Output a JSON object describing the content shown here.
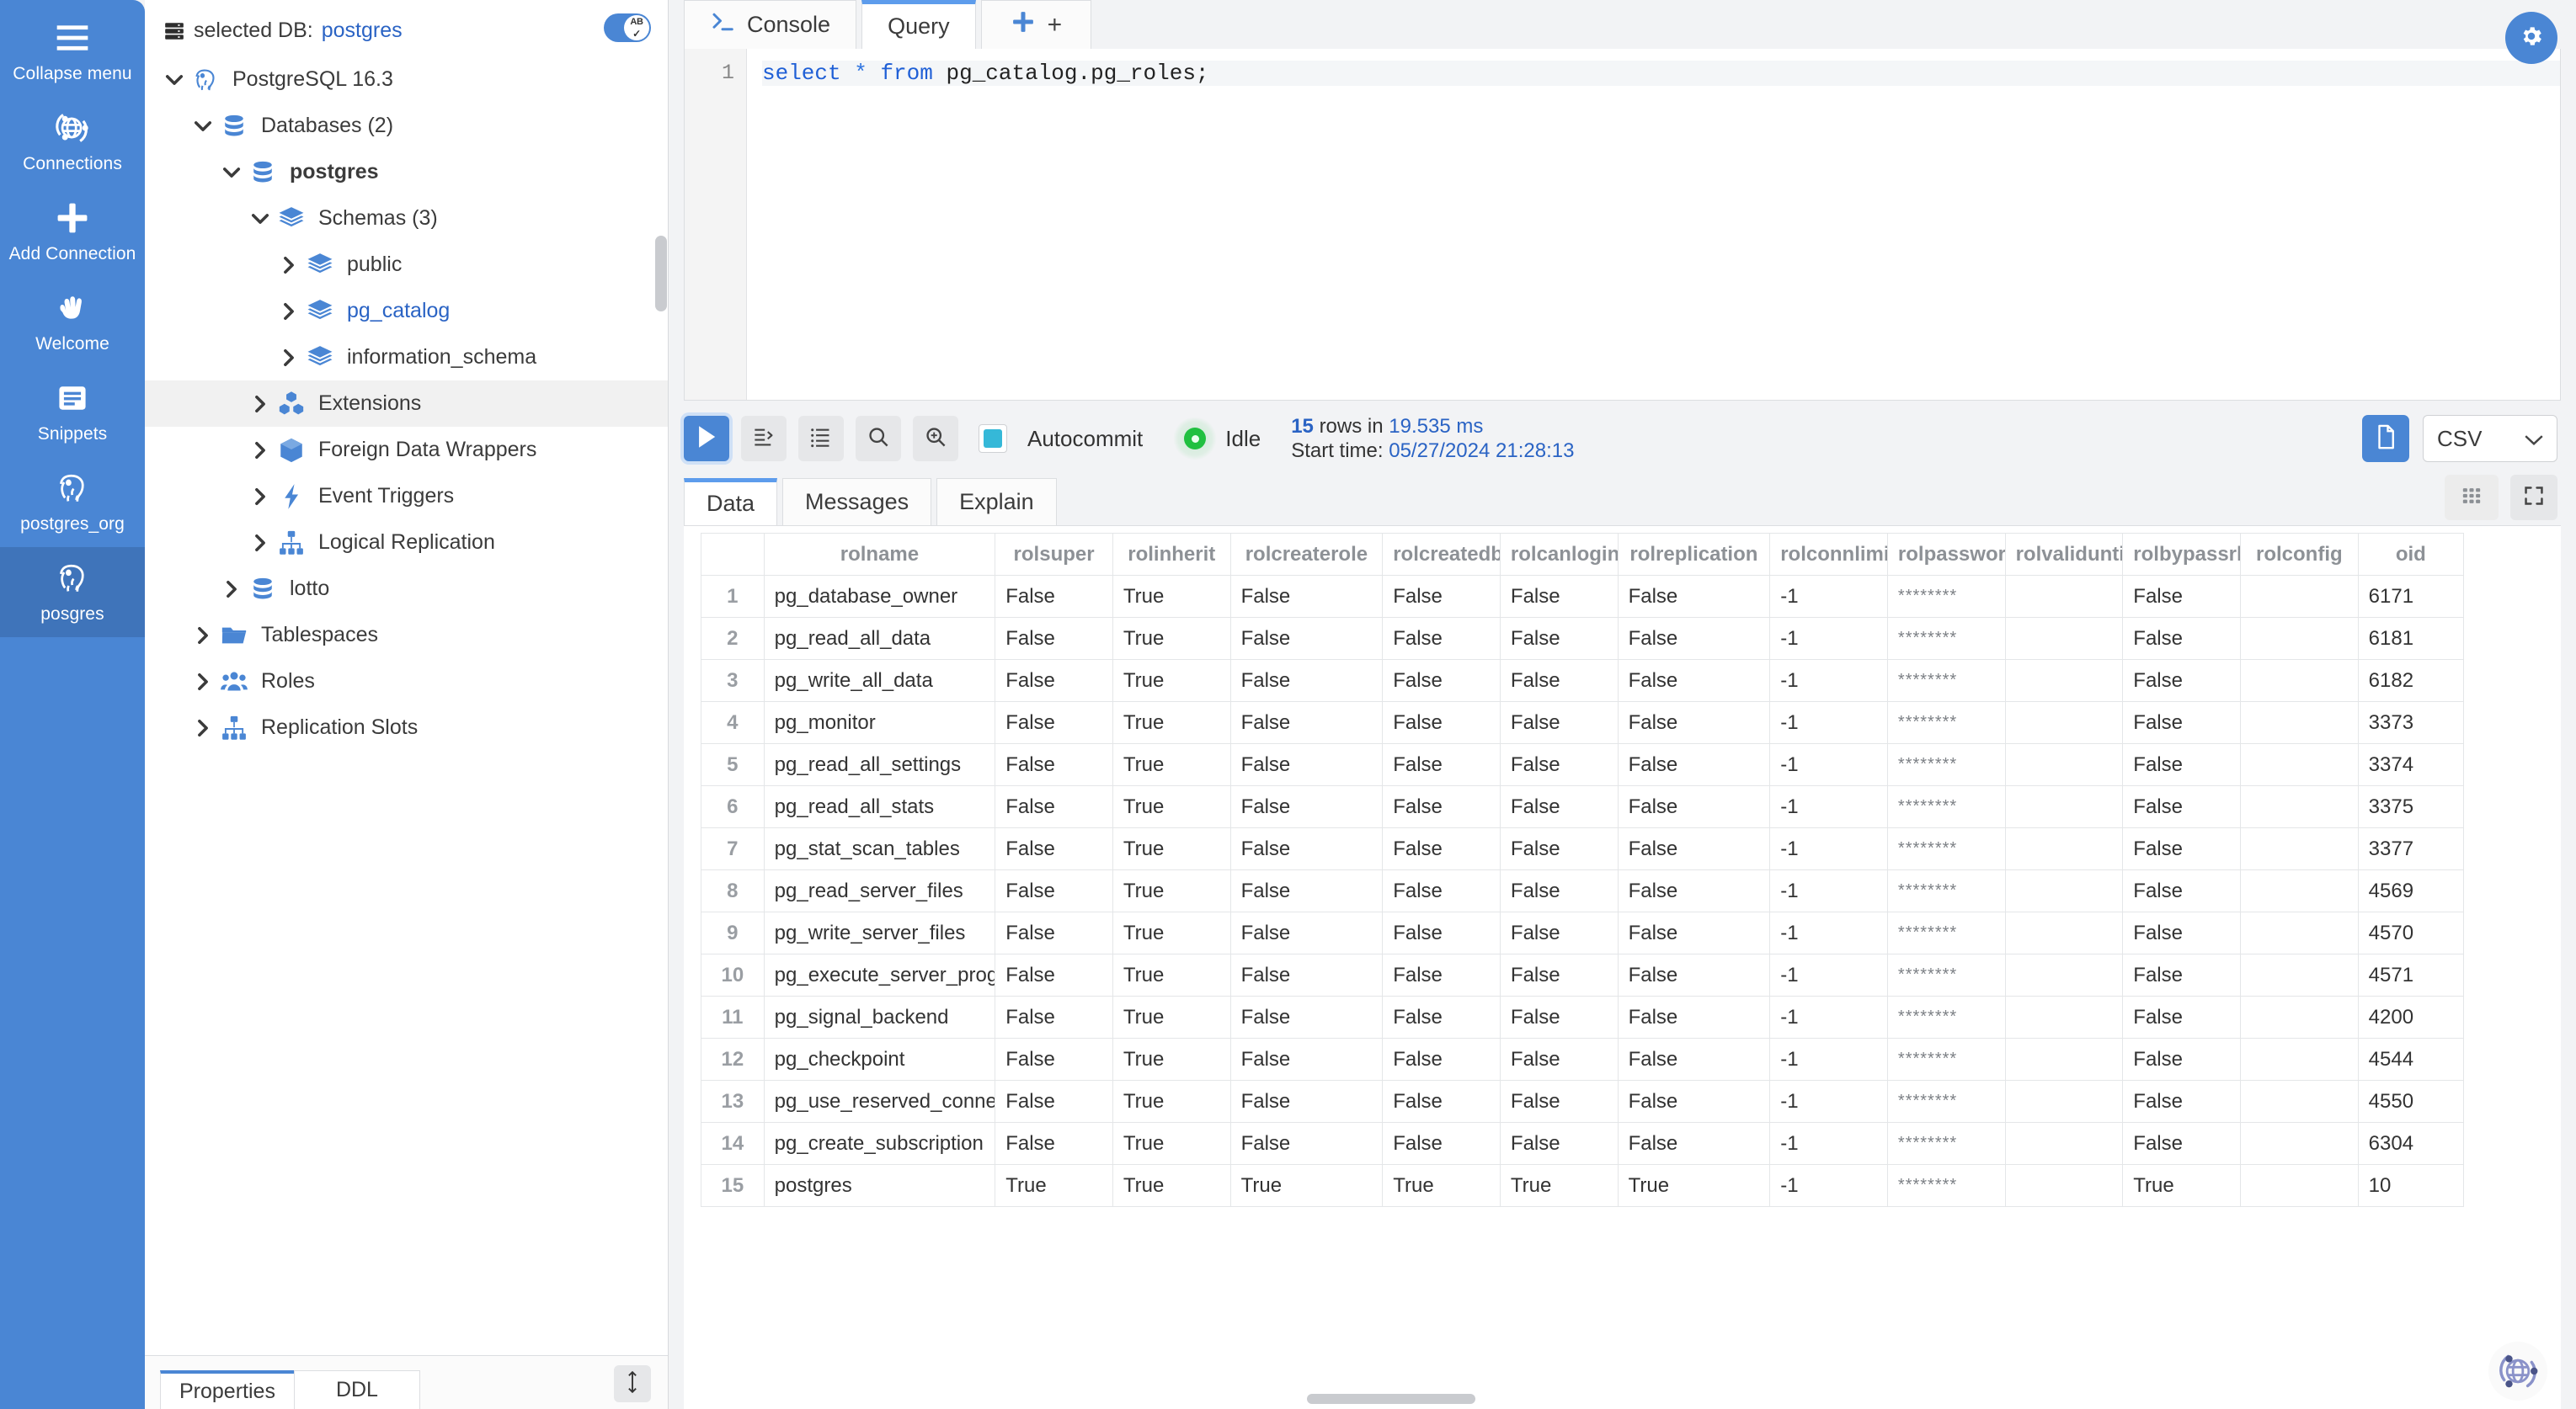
{
  "rail": {
    "items": [
      {
        "label": "Collapse menu",
        "icon": "hamburger-menu-icon",
        "active": false
      },
      {
        "label": "Connections",
        "icon": "connections-globe-icon",
        "active": false
      },
      {
        "label": "Add Connection",
        "icon": "plus-icon",
        "active": false
      },
      {
        "label": "Welcome",
        "icon": "hand-wave-icon",
        "active": false
      },
      {
        "label": "Snippets",
        "icon": "snippets-book-icon",
        "active": false
      },
      {
        "label": "postgres_org",
        "icon": "postgres-elephant-icon",
        "active": false
      },
      {
        "label": "posgres",
        "icon": "postgres-elephant-icon",
        "active": true
      }
    ]
  },
  "tree": {
    "header": {
      "prefix": "selected DB:",
      "db": "postgres",
      "icon": "server-icon"
    },
    "autocomplete_toggle": {
      "label": "AB",
      "state": "on",
      "icon": "ab-check-icon"
    },
    "nodes": [
      {
        "label": "PostgreSQL 16.3",
        "indent": 0,
        "state": "expanded",
        "icon": "postgres-elephant-icon",
        "style": "normal"
      },
      {
        "label": "Databases (2)",
        "indent": 1,
        "state": "expanded",
        "icon": "database-icon",
        "style": "normal"
      },
      {
        "label": "postgres",
        "indent": 2,
        "state": "expanded",
        "icon": "database-icon",
        "style": "bold"
      },
      {
        "label": "Schemas (3)",
        "indent": 3,
        "state": "expanded",
        "icon": "schema-layers-icon",
        "style": "normal"
      },
      {
        "label": "public",
        "indent": 4,
        "state": "collapsed",
        "icon": "schema-layers-icon",
        "style": "normal"
      },
      {
        "label": "pg_catalog",
        "indent": 4,
        "state": "collapsed",
        "icon": "schema-layers-icon",
        "style": "link"
      },
      {
        "label": "information_schema",
        "indent": 4,
        "state": "collapsed",
        "icon": "schema-layers-icon",
        "style": "normal"
      },
      {
        "label": "Extensions",
        "indent": 3,
        "state": "collapsed",
        "icon": "extensions-cubes-icon",
        "style": "normal",
        "highlighted": true
      },
      {
        "label": "Foreign Data Wrappers",
        "indent": 3,
        "state": "collapsed",
        "icon": "cube-icon",
        "style": "normal"
      },
      {
        "label": "Event Triggers",
        "indent": 3,
        "state": "collapsed",
        "icon": "lightning-bolt-icon",
        "style": "normal"
      },
      {
        "label": "Logical Replication",
        "indent": 3,
        "state": "collapsed",
        "icon": "hierarchy-icon",
        "style": "normal"
      },
      {
        "label": "lotto",
        "indent": 2,
        "state": "collapsed",
        "icon": "database-icon",
        "style": "normal"
      },
      {
        "label": "Tablespaces",
        "indent": 1,
        "state": "collapsed",
        "icon": "folder-icon",
        "style": "normal"
      },
      {
        "label": "Roles",
        "indent": 1,
        "state": "collapsed",
        "icon": "roles-users-icon",
        "style": "normal"
      },
      {
        "label": "Replication Slots",
        "indent": 1,
        "state": "collapsed",
        "icon": "hierarchy-icon",
        "style": "normal"
      }
    ],
    "footer_tabs": [
      {
        "label": "Properties",
        "active": true
      },
      {
        "label": "DDL",
        "active": false
      }
    ],
    "resize_button_icon": "up-down-arrow-icon"
  },
  "editor": {
    "tabs": [
      {
        "label": "Console",
        "icon": "terminal-prompt-icon",
        "active": false
      },
      {
        "label": "Query",
        "icon": "",
        "active": true
      },
      {
        "label": "+",
        "icon": "plus-icon",
        "active": false
      }
    ],
    "line_number": "1",
    "sql": {
      "kw_select": "select",
      "star": "*",
      "kw_from": "from",
      "target": "pg_catalog.pg_roles;"
    }
  },
  "results_toolbar": {
    "buttons": [
      {
        "name": "run-query-button",
        "icon": "play-icon"
      },
      {
        "name": "run-script-button",
        "icon": "run-script-icon"
      },
      {
        "name": "list-view-button",
        "icon": "list-icon"
      },
      {
        "name": "search-button",
        "icon": "search-icon"
      },
      {
        "name": "zoom-search-button",
        "icon": "search-plus-icon"
      }
    ],
    "autocommit_label": "Autocommit",
    "autocommit_checked": true,
    "status_label": "Idle",
    "status_color": "#20c040",
    "rows_count": "15",
    "rows_mid": "rows in",
    "duration": "19.535 ms",
    "start_time_label": "Start time:",
    "start_time_value": "05/27/2024 21:28:13",
    "export_button_icon": "document-icon",
    "format_select_value": "CSV",
    "format_chevron_icon": "chevron-down-icon"
  },
  "result_tabs": [
    {
      "label": "Data",
      "active": true
    },
    {
      "label": "Messages",
      "active": false
    },
    {
      "label": "Explain",
      "active": false
    }
  ],
  "result_tab_actions": [
    {
      "name": "grid-layout-button",
      "icon": "grid-icon"
    },
    {
      "name": "fullscreen-button",
      "icon": "expand-icon"
    }
  ],
  "gear_button": {
    "icon": "gear-icon"
  },
  "corner_logo": {
    "icon": "globe-network-icon"
  },
  "grid": {
    "columns": [
      {
        "key": "rowno",
        "label": "",
        "cls": "c-rowno"
      },
      {
        "key": "rolname",
        "label": "rolname",
        "cls": "c-rolname"
      },
      {
        "key": "rolsuper",
        "label": "rolsuper",
        "cls": "c-b"
      },
      {
        "key": "rolinherit",
        "label": "rolinherit",
        "cls": "c-b"
      },
      {
        "key": "rolcreaterole",
        "label": "rolcreaterole",
        "cls": "c-w"
      },
      {
        "key": "rolcreatedb",
        "label": "rolcreatedb",
        "cls": "c-b"
      },
      {
        "key": "rolcanlogin",
        "label": "rolcanlogin",
        "cls": "c-b"
      },
      {
        "key": "rolreplication",
        "label": "rolreplication",
        "cls": "c-w"
      },
      {
        "key": "rolconnlimit",
        "label": "rolconnlimit",
        "cls": "c-b"
      },
      {
        "key": "rolpassword",
        "label": "rolpassword",
        "cls": "c-b"
      },
      {
        "key": "rolvaliduntil",
        "label": "rolvaliduntil",
        "cls": "c-b"
      },
      {
        "key": "rolbypassrls",
        "label": "rolbypassrls",
        "cls": "c-b"
      },
      {
        "key": "rolconfig",
        "label": "rolconfig",
        "cls": "c-b"
      },
      {
        "key": "oid",
        "label": "oid",
        "cls": "c-oid"
      }
    ],
    "rows": [
      {
        "rowno": "1",
        "rolname": "pg_database_owner",
        "rolsuper": "False",
        "rolinherit": "True",
        "rolcreaterole": "False",
        "rolcreatedb": "False",
        "rolcanlogin": "False",
        "rolreplication": "False",
        "rolconnlimit": "-1",
        "rolpassword": "********",
        "rolvaliduntil": "",
        "rolbypassrls": "False",
        "rolconfig": "",
        "oid": "6171"
      },
      {
        "rowno": "2",
        "rolname": "pg_read_all_data",
        "rolsuper": "False",
        "rolinherit": "True",
        "rolcreaterole": "False",
        "rolcreatedb": "False",
        "rolcanlogin": "False",
        "rolreplication": "False",
        "rolconnlimit": "-1",
        "rolpassword": "********",
        "rolvaliduntil": "",
        "rolbypassrls": "False",
        "rolconfig": "",
        "oid": "6181"
      },
      {
        "rowno": "3",
        "rolname": "pg_write_all_data",
        "rolsuper": "False",
        "rolinherit": "True",
        "rolcreaterole": "False",
        "rolcreatedb": "False",
        "rolcanlogin": "False",
        "rolreplication": "False",
        "rolconnlimit": "-1",
        "rolpassword": "********",
        "rolvaliduntil": "",
        "rolbypassrls": "False",
        "rolconfig": "",
        "oid": "6182"
      },
      {
        "rowno": "4",
        "rolname": "pg_monitor",
        "rolsuper": "False",
        "rolinherit": "True",
        "rolcreaterole": "False",
        "rolcreatedb": "False",
        "rolcanlogin": "False",
        "rolreplication": "False",
        "rolconnlimit": "-1",
        "rolpassword": "********",
        "rolvaliduntil": "",
        "rolbypassrls": "False",
        "rolconfig": "",
        "oid": "3373"
      },
      {
        "rowno": "5",
        "rolname": "pg_read_all_settings",
        "rolsuper": "False",
        "rolinherit": "True",
        "rolcreaterole": "False",
        "rolcreatedb": "False",
        "rolcanlogin": "False",
        "rolreplication": "False",
        "rolconnlimit": "-1",
        "rolpassword": "********",
        "rolvaliduntil": "",
        "rolbypassrls": "False",
        "rolconfig": "",
        "oid": "3374"
      },
      {
        "rowno": "6",
        "rolname": "pg_read_all_stats",
        "rolsuper": "False",
        "rolinherit": "True",
        "rolcreaterole": "False",
        "rolcreatedb": "False",
        "rolcanlogin": "False",
        "rolreplication": "False",
        "rolconnlimit": "-1",
        "rolpassword": "********",
        "rolvaliduntil": "",
        "rolbypassrls": "False",
        "rolconfig": "",
        "oid": "3375"
      },
      {
        "rowno": "7",
        "rolname": "pg_stat_scan_tables",
        "rolsuper": "False",
        "rolinherit": "True",
        "rolcreaterole": "False",
        "rolcreatedb": "False",
        "rolcanlogin": "False",
        "rolreplication": "False",
        "rolconnlimit": "-1",
        "rolpassword": "********",
        "rolvaliduntil": "",
        "rolbypassrls": "False",
        "rolconfig": "",
        "oid": "3377"
      },
      {
        "rowno": "8",
        "rolname": "pg_read_server_files",
        "rolsuper": "False",
        "rolinherit": "True",
        "rolcreaterole": "False",
        "rolcreatedb": "False",
        "rolcanlogin": "False",
        "rolreplication": "False",
        "rolconnlimit": "-1",
        "rolpassword": "********",
        "rolvaliduntil": "",
        "rolbypassrls": "False",
        "rolconfig": "",
        "oid": "4569"
      },
      {
        "rowno": "9",
        "rolname": "pg_write_server_files",
        "rolsuper": "False",
        "rolinherit": "True",
        "rolcreaterole": "False",
        "rolcreatedb": "False",
        "rolcanlogin": "False",
        "rolreplication": "False",
        "rolconnlimit": "-1",
        "rolpassword": "********",
        "rolvaliduntil": "",
        "rolbypassrls": "False",
        "rolconfig": "",
        "oid": "4570"
      },
      {
        "rowno": "10",
        "rolname": "pg_execute_server_program",
        "rolsuper": "False",
        "rolinherit": "True",
        "rolcreaterole": "False",
        "rolcreatedb": "False",
        "rolcanlogin": "False",
        "rolreplication": "False",
        "rolconnlimit": "-1",
        "rolpassword": "********",
        "rolvaliduntil": "",
        "rolbypassrls": "False",
        "rolconfig": "",
        "oid": "4571"
      },
      {
        "rowno": "11",
        "rolname": "pg_signal_backend",
        "rolsuper": "False",
        "rolinherit": "True",
        "rolcreaterole": "False",
        "rolcreatedb": "False",
        "rolcanlogin": "False",
        "rolreplication": "False",
        "rolconnlimit": "-1",
        "rolpassword": "********",
        "rolvaliduntil": "",
        "rolbypassrls": "False",
        "rolconfig": "",
        "oid": "4200"
      },
      {
        "rowno": "12",
        "rolname": "pg_checkpoint",
        "rolsuper": "False",
        "rolinherit": "True",
        "rolcreaterole": "False",
        "rolcreatedb": "False",
        "rolcanlogin": "False",
        "rolreplication": "False",
        "rolconnlimit": "-1",
        "rolpassword": "********",
        "rolvaliduntil": "",
        "rolbypassrls": "False",
        "rolconfig": "",
        "oid": "4544"
      },
      {
        "rowno": "13",
        "rolname": "pg_use_reserved_connections",
        "rolsuper": "False",
        "rolinherit": "True",
        "rolcreaterole": "False",
        "rolcreatedb": "False",
        "rolcanlogin": "False",
        "rolreplication": "False",
        "rolconnlimit": "-1",
        "rolpassword": "********",
        "rolvaliduntil": "",
        "rolbypassrls": "False",
        "rolconfig": "",
        "oid": "4550"
      },
      {
        "rowno": "14",
        "rolname": "pg_create_subscription",
        "rolsuper": "False",
        "rolinherit": "True",
        "rolcreaterole": "False",
        "rolcreatedb": "False",
        "rolcanlogin": "False",
        "rolreplication": "False",
        "rolconnlimit": "-1",
        "rolpassword": "********",
        "rolvaliduntil": "",
        "rolbypassrls": "False",
        "rolconfig": "",
        "oid": "6304"
      },
      {
        "rowno": "15",
        "rolname": "postgres",
        "rolsuper": "True",
        "rolinherit": "True",
        "rolcreaterole": "True",
        "rolcreatedb": "True",
        "rolcanlogin": "True",
        "rolreplication": "True",
        "rolconnlimit": "-1",
        "rolpassword": "********",
        "rolvaliduntil": "",
        "rolbypassrls": "True",
        "rolconfig": "",
        "oid": "10"
      }
    ]
  }
}
